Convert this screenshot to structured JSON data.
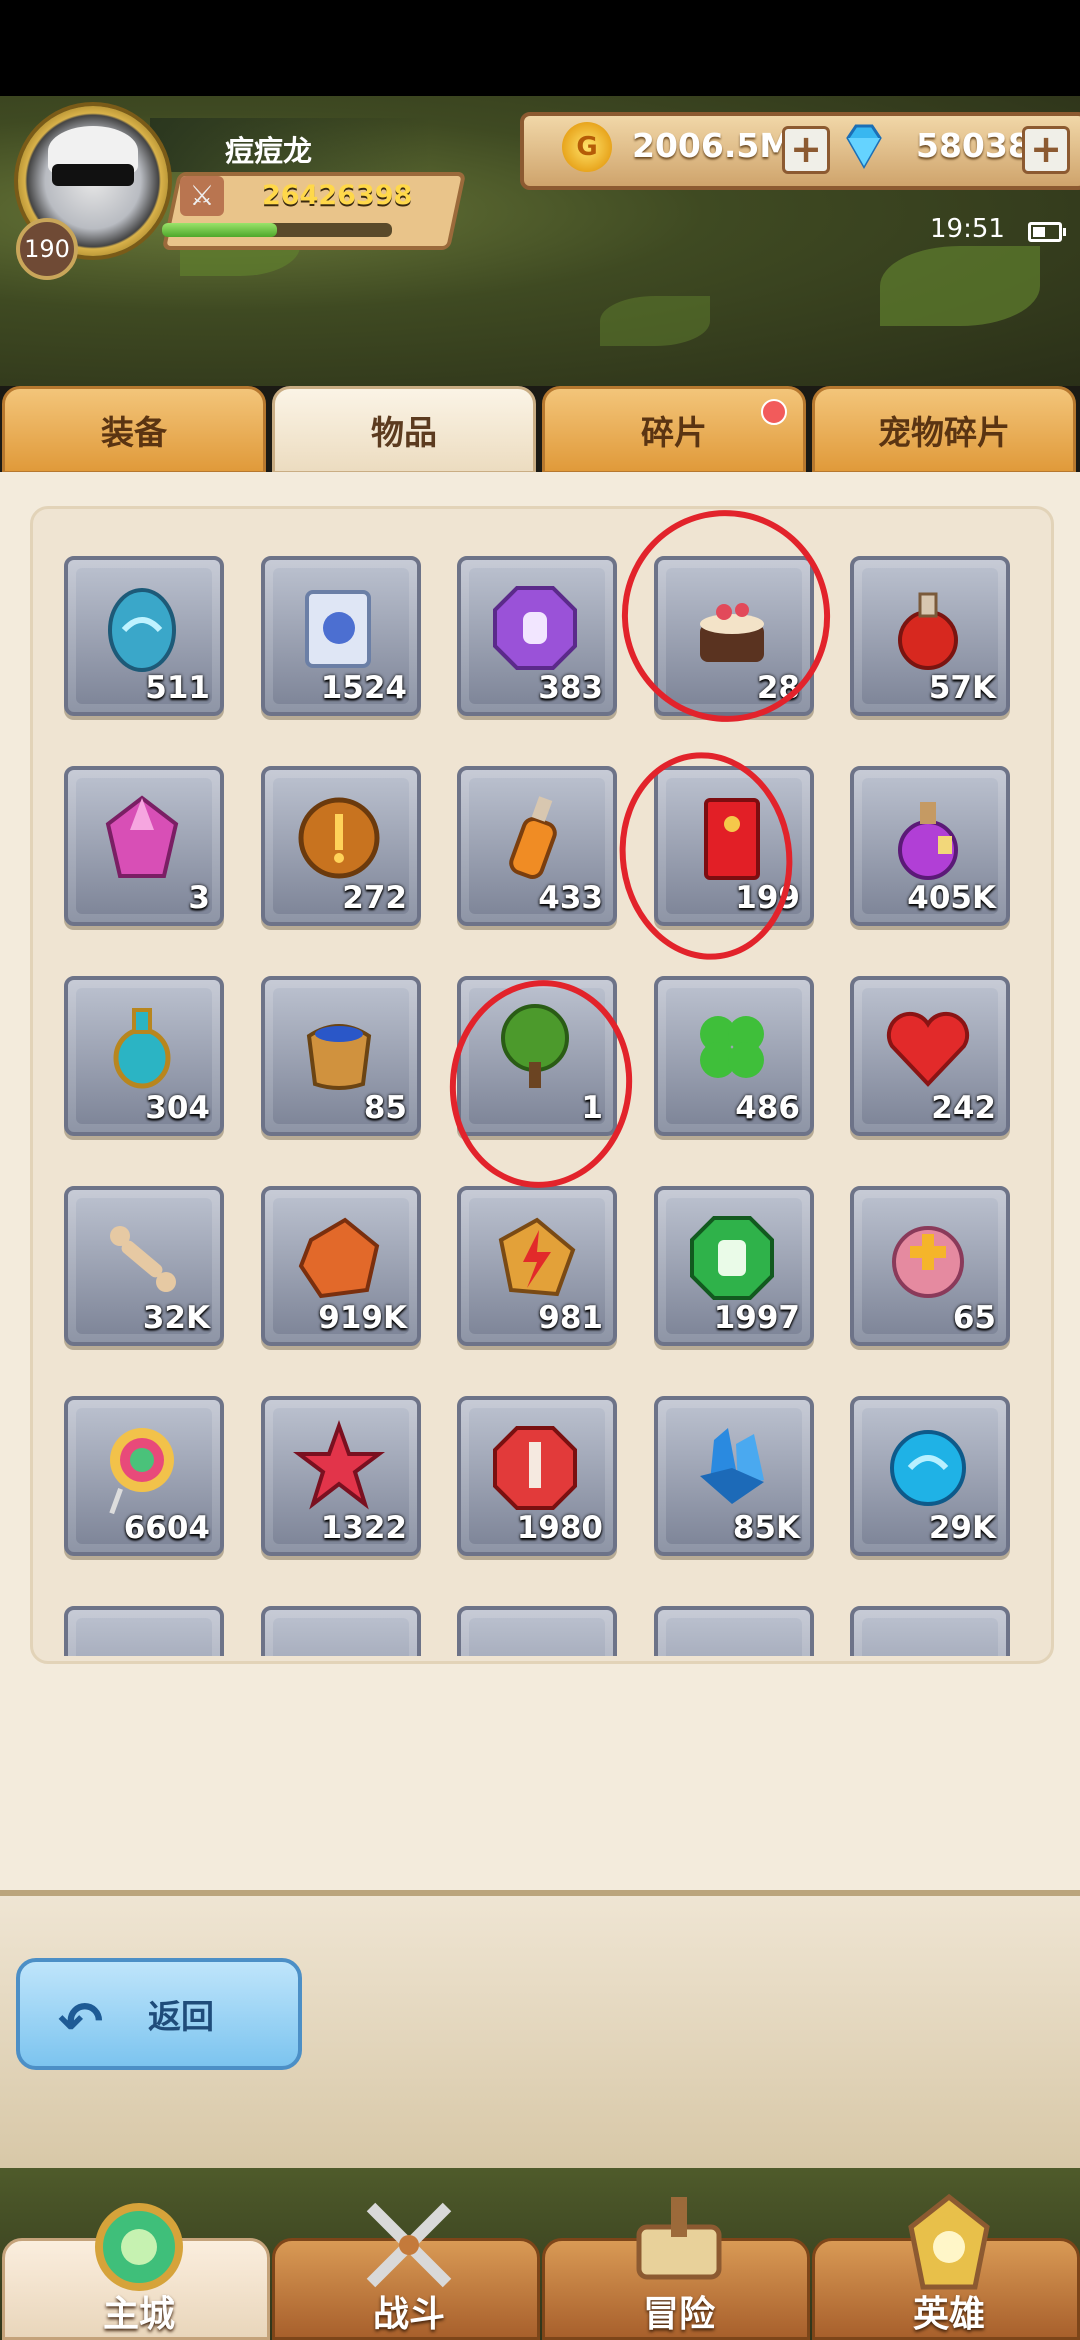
{
  "header": {
    "player_name": "痘痘龙",
    "level": "190",
    "power": "26426398",
    "exp_fraction": 0.5,
    "gold": "2006.5M",
    "gems": "58038",
    "plus_symbol": "+",
    "time": "19:51"
  },
  "tabs": [
    {
      "label": "装备",
      "active": false,
      "dot": false
    },
    {
      "label": "物品",
      "active": true,
      "dot": false
    },
    {
      "label": "碎片",
      "active": false,
      "dot": true
    },
    {
      "label": "宠物碎片",
      "active": false,
      "dot": false
    }
  ],
  "items": [
    {
      "name": "blue-egg",
      "count": "511"
    },
    {
      "name": "scroll",
      "count": "1524"
    },
    {
      "name": "purple-helmet-gem",
      "count": "383"
    },
    {
      "name": "cake",
      "count": "28"
    },
    {
      "name": "red-potion",
      "count": "57K"
    },
    {
      "name": "pink-crystal",
      "count": "3"
    },
    {
      "name": "bronze-coin",
      "count": "272"
    },
    {
      "name": "orange-potion",
      "count": "433"
    },
    {
      "name": "red-envelope",
      "count": "199"
    },
    {
      "name": "purple-potion",
      "count": "405K"
    },
    {
      "name": "teal-vase",
      "count": "304"
    },
    {
      "name": "sack",
      "count": "85"
    },
    {
      "name": "tree",
      "count": "1"
    },
    {
      "name": "clover",
      "count": "486"
    },
    {
      "name": "heart",
      "count": "242"
    },
    {
      "name": "bone",
      "count": "32K"
    },
    {
      "name": "orange-ore",
      "count": "919K"
    },
    {
      "name": "lightning-stone",
      "count": "981"
    },
    {
      "name": "green-glove-gem",
      "count": "1997"
    },
    {
      "name": "heal-orb",
      "count": "65"
    },
    {
      "name": "lollipop",
      "count": "6604"
    },
    {
      "name": "red-star",
      "count": "1322"
    },
    {
      "name": "red-sword-gem",
      "count": "1980"
    },
    {
      "name": "blue-crystals",
      "count": "85K"
    },
    {
      "name": "blue-orb",
      "count": "29K"
    },
    {
      "name": "partial-1",
      "count": ""
    },
    {
      "name": "partial-2",
      "count": ""
    },
    {
      "name": "partial-3",
      "count": ""
    },
    {
      "name": "partial-4",
      "count": ""
    },
    {
      "name": "partial-5",
      "count": ""
    }
  ],
  "back_button": {
    "label": "返回"
  },
  "nav": [
    {
      "label": "主城",
      "active": true
    },
    {
      "label": "战斗",
      "active": false
    },
    {
      "label": "冒险",
      "active": false
    },
    {
      "label": "英雄",
      "active": false
    }
  ]
}
